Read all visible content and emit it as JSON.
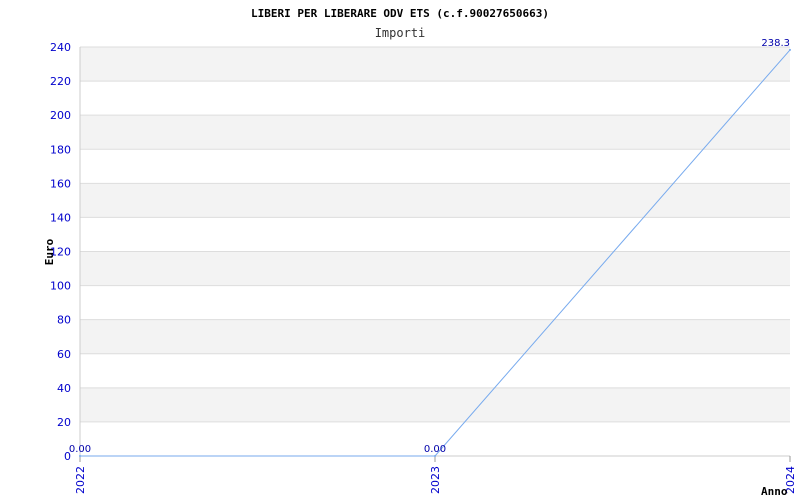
{
  "chart_data": {
    "type": "line",
    "title": "LIBERI PER LIBERARE ODV ETS (c.f.90027650663)",
    "subtitle": "Importi",
    "xlabel": "Anno",
    "ylabel": "Euro",
    "categories": [
      "2022",
      "2023",
      "2024"
    ],
    "series": [
      {
        "values": [
          0.0,
          0.0,
          238.3
        ],
        "labels": [
          "0.00",
          "0.00",
          "238.3"
        ]
      }
    ],
    "ylim": [
      0,
      240
    ],
    "yticks": [
      0,
      20,
      40,
      60,
      80,
      100,
      120,
      140,
      160,
      180,
      200,
      220,
      240
    ],
    "grid": true,
    "line_color": "#77aaee",
    "tick_color": "#0000cc",
    "band_color": "#f3f3f3"
  }
}
